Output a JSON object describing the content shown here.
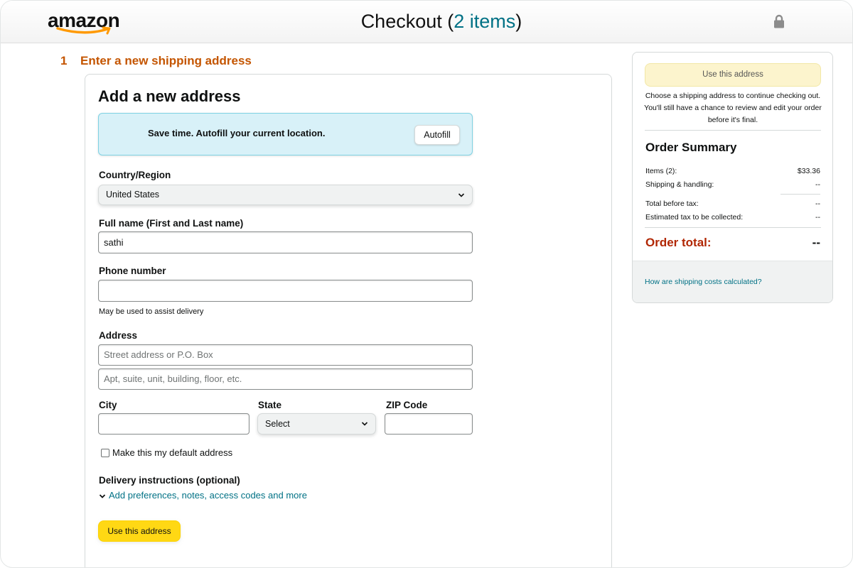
{
  "header": {
    "logo_text": "amazon",
    "title": "Checkout",
    "count_open": " (",
    "count": "2 items",
    "count_close": ")",
    "lock_icon": "lock-icon"
  },
  "step": {
    "number": "1",
    "label": "Enter a new shipping address"
  },
  "form": {
    "title": "Add a new address",
    "autofill": {
      "message": "Save time. Autofill your current location.",
      "button_label": "Autofill"
    },
    "country_label": "Country/Region",
    "country_value": "United States",
    "fullname_label": "Full name (First and Last name)",
    "fullname_value": "sathi",
    "phone_label": "Phone number",
    "phone_value": "",
    "phone_hint": "May be used to assist delivery",
    "address_label": "Address",
    "address_line1_placeholder": "Street address or P.O. Box",
    "address_line2_placeholder": "Apt, suite, unit, building, floor, etc.",
    "city_label": "City",
    "city_value": "",
    "state_label": "State",
    "state_value": "Select",
    "zip_label": "ZIP Code",
    "zip_value": "",
    "default_checkbox_label": "Make this my default address",
    "default_checked": false,
    "delivery_label": "Delivery instructions (optional)",
    "delivery_link": "Add preferences, notes, access codes and more",
    "submit_label": "Use this address"
  },
  "summary": {
    "button_label": "Use this address",
    "note": "Choose a shipping address to continue checking out. You'll still have a chance to review and edit your order before it's final.",
    "title": "Order Summary",
    "rows": [
      {
        "label": "Items (2):",
        "value": "$33.36"
      },
      {
        "label": "Shipping & handling:",
        "value": "--"
      },
      {
        "label": "Total before tax:",
        "value": "--"
      },
      {
        "label": "Estimated tax to be collected:",
        "value": "--"
      }
    ],
    "total_label": "Order total:",
    "total_value": "--",
    "shipping_link": "How are shipping costs calculated?"
  },
  "colors": {
    "accent_orange": "#c45500",
    "link_teal": "#007185",
    "button_yellow": "#ffd814",
    "total_red": "#b12704"
  }
}
